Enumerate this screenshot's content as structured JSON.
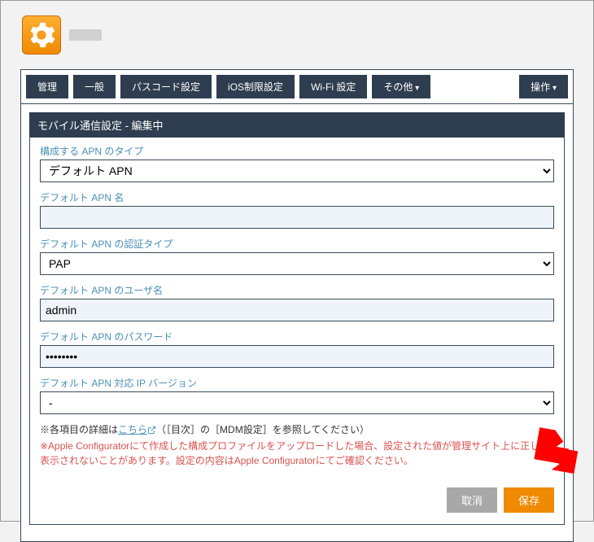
{
  "tabs": {
    "manage": "管理",
    "general": "一般",
    "passcode": "パスコード設定",
    "iosrestrict": "iOS制限設定",
    "wifi": "Wi-Fi 設定",
    "other": "その他",
    "action": "操作"
  },
  "section_title": "モバイル通信設定 - 編集中",
  "form": {
    "apn_type": {
      "label": "構成する APN のタイプ",
      "value": "デフォルト APN"
    },
    "apn_name": {
      "label": "デフォルト APN 名",
      "value": ""
    },
    "apn_auth": {
      "label": "デフォルト APN の認証タイプ",
      "value": "PAP"
    },
    "apn_user": {
      "label": "デフォルト APN のユーザ名",
      "value": "admin"
    },
    "apn_pass": {
      "label": "デフォルト APN のパスワード",
      "value": "••••••••"
    },
    "apn_ipver": {
      "label": "デフォルト APN 対応 IP バージョン",
      "value": "-"
    }
  },
  "note": {
    "pre": "※各項目の詳細は",
    "link": "こちら",
    "post": "（［目次］の［MDM設定］を参照してください）",
    "warn": "※Apple Configuratorにて作成した構成プロファイルをアップロードした場合、設定された値が管理サイト上に正しく表示されないことがあります。設定の内容はApple Configuratorにてご確認ください。"
  },
  "buttons": {
    "cancel": "取消",
    "save": "保存"
  }
}
